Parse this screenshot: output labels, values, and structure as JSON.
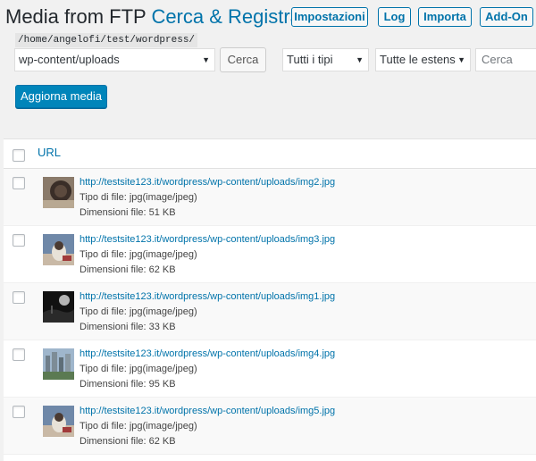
{
  "header": {
    "title": "Media from FTP",
    "title_link": "Cerca & Registra",
    "buttons": {
      "settings": "Impostazioni",
      "log": "Log",
      "import": "Importa",
      "addon": "Add-On"
    }
  },
  "toolbar": {
    "path": "/home/angelofi/test/wordpress/",
    "directory": "wp-content/uploads",
    "search_button": "Cerca",
    "type_filter": "Tutti i tipi",
    "extension_filter": "Tutte le estens",
    "search_placeholder": "Cerca",
    "update_button": "Aggiorna media"
  },
  "table": {
    "column_url": "URL",
    "rows": [
      {
        "url": "http://testsite123.it/wordpress/wp-content/uploads/img2.jpg",
        "type": "Tipo di file: jpg(image/jpeg)",
        "size": "Dimensioni file: 51 KB"
      },
      {
        "url": "http://testsite123.it/wordpress/wp-content/uploads/img3.jpg",
        "type": "Tipo di file: jpg(image/jpeg)",
        "size": "Dimensioni file: 62 KB"
      },
      {
        "url": "http://testsite123.it/wordpress/wp-content/uploads/img1.jpg",
        "type": "Tipo di file: jpg(image/jpeg)",
        "size": "Dimensioni file: 33 KB"
      },
      {
        "url": "http://testsite123.it/wordpress/wp-content/uploads/img4.jpg",
        "type": "Tipo di file: jpg(image/jpeg)",
        "size": "Dimensioni file: 95 KB"
      },
      {
        "url": "http://testsite123.it/wordpress/wp-content/uploads/img5.jpg",
        "type": "Tipo di file: jpg(image/jpeg)",
        "size": "Dimensioni file: 62 KB"
      }
    ]
  },
  "colors": {
    "accent": "#0073aa",
    "primary_button": "#0085ba",
    "background": "#f1f1f1"
  }
}
